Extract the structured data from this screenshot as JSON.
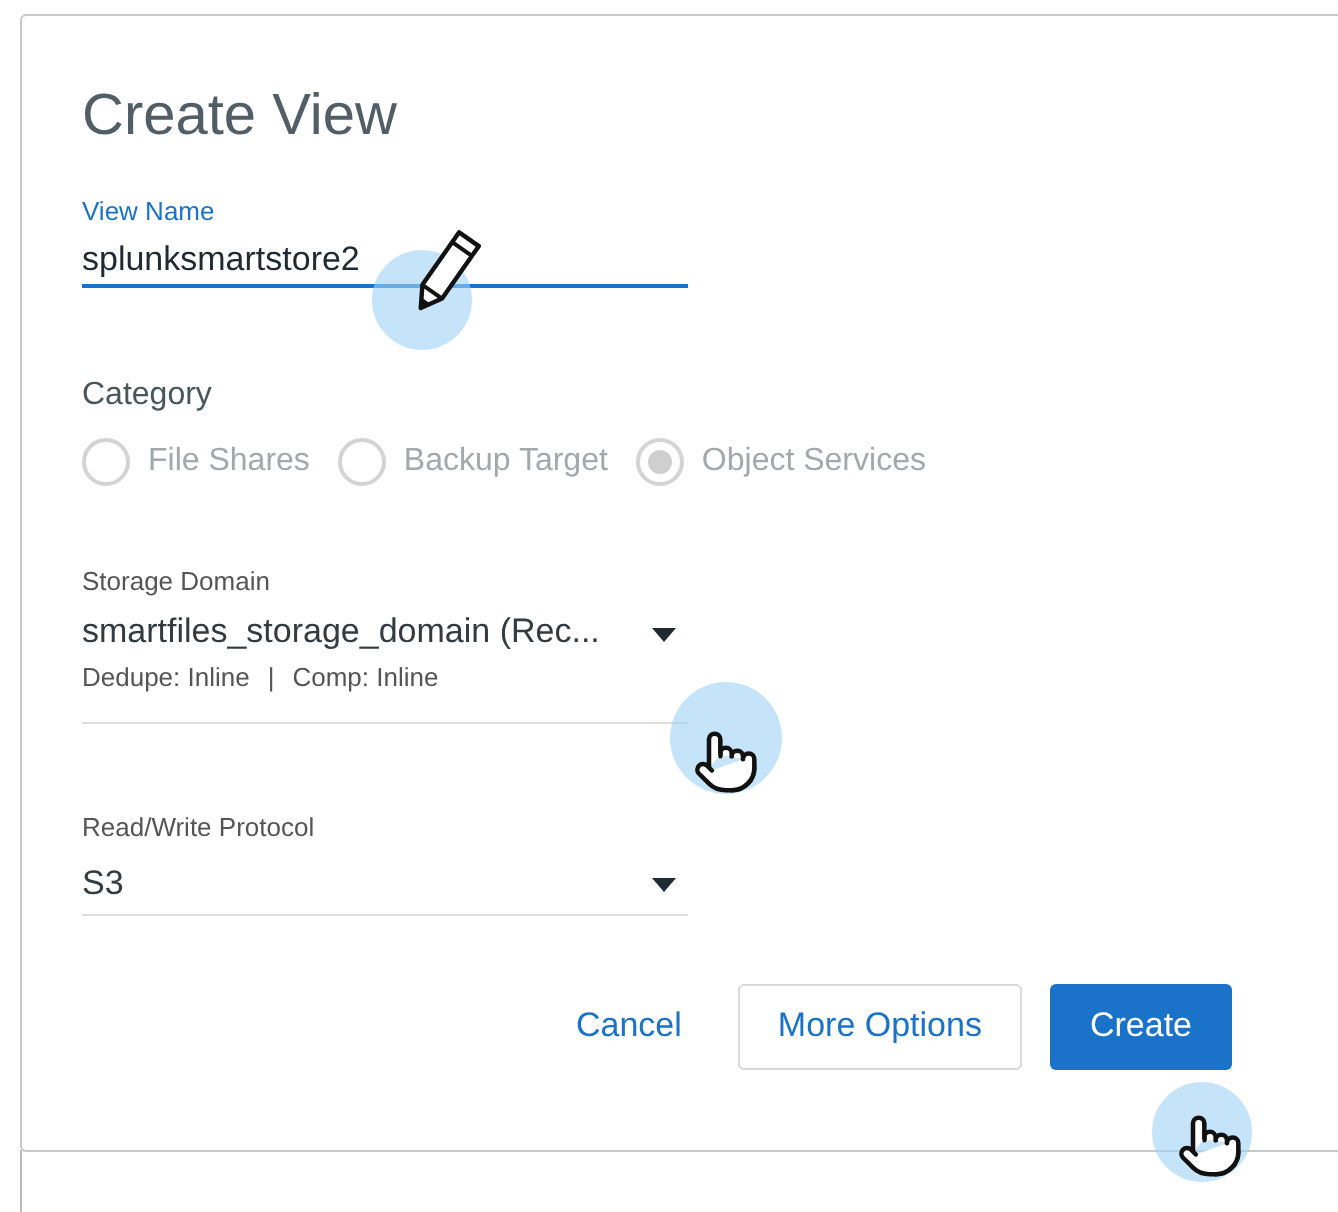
{
  "dialog": {
    "title": "Create View"
  },
  "view_name": {
    "label": "View Name",
    "value": "splunksmartstore2",
    "focused": true
  },
  "category": {
    "label": "Category",
    "options": [
      {
        "label": "File Shares",
        "selected": false,
        "disabled": true
      },
      {
        "label": "Backup Target",
        "selected": false,
        "disabled": true
      },
      {
        "label": "Object Services",
        "selected": true,
        "disabled": true
      }
    ]
  },
  "storage_domain": {
    "label": "Storage Domain",
    "value": "smartfiles_storage_domain (Rec...",
    "details": [
      {
        "text": "Dedupe: Inline"
      },
      {
        "text": "|"
      },
      {
        "text": "Comp: Inline"
      }
    ]
  },
  "protocol": {
    "label": "Read/Write Protocol",
    "value": "S3"
  },
  "buttons": [
    {
      "label": "Cancel",
      "kind": "link"
    },
    {
      "label": "More Options",
      "kind": "outline"
    },
    {
      "label": "Create",
      "kind": "primary"
    }
  ]
}
